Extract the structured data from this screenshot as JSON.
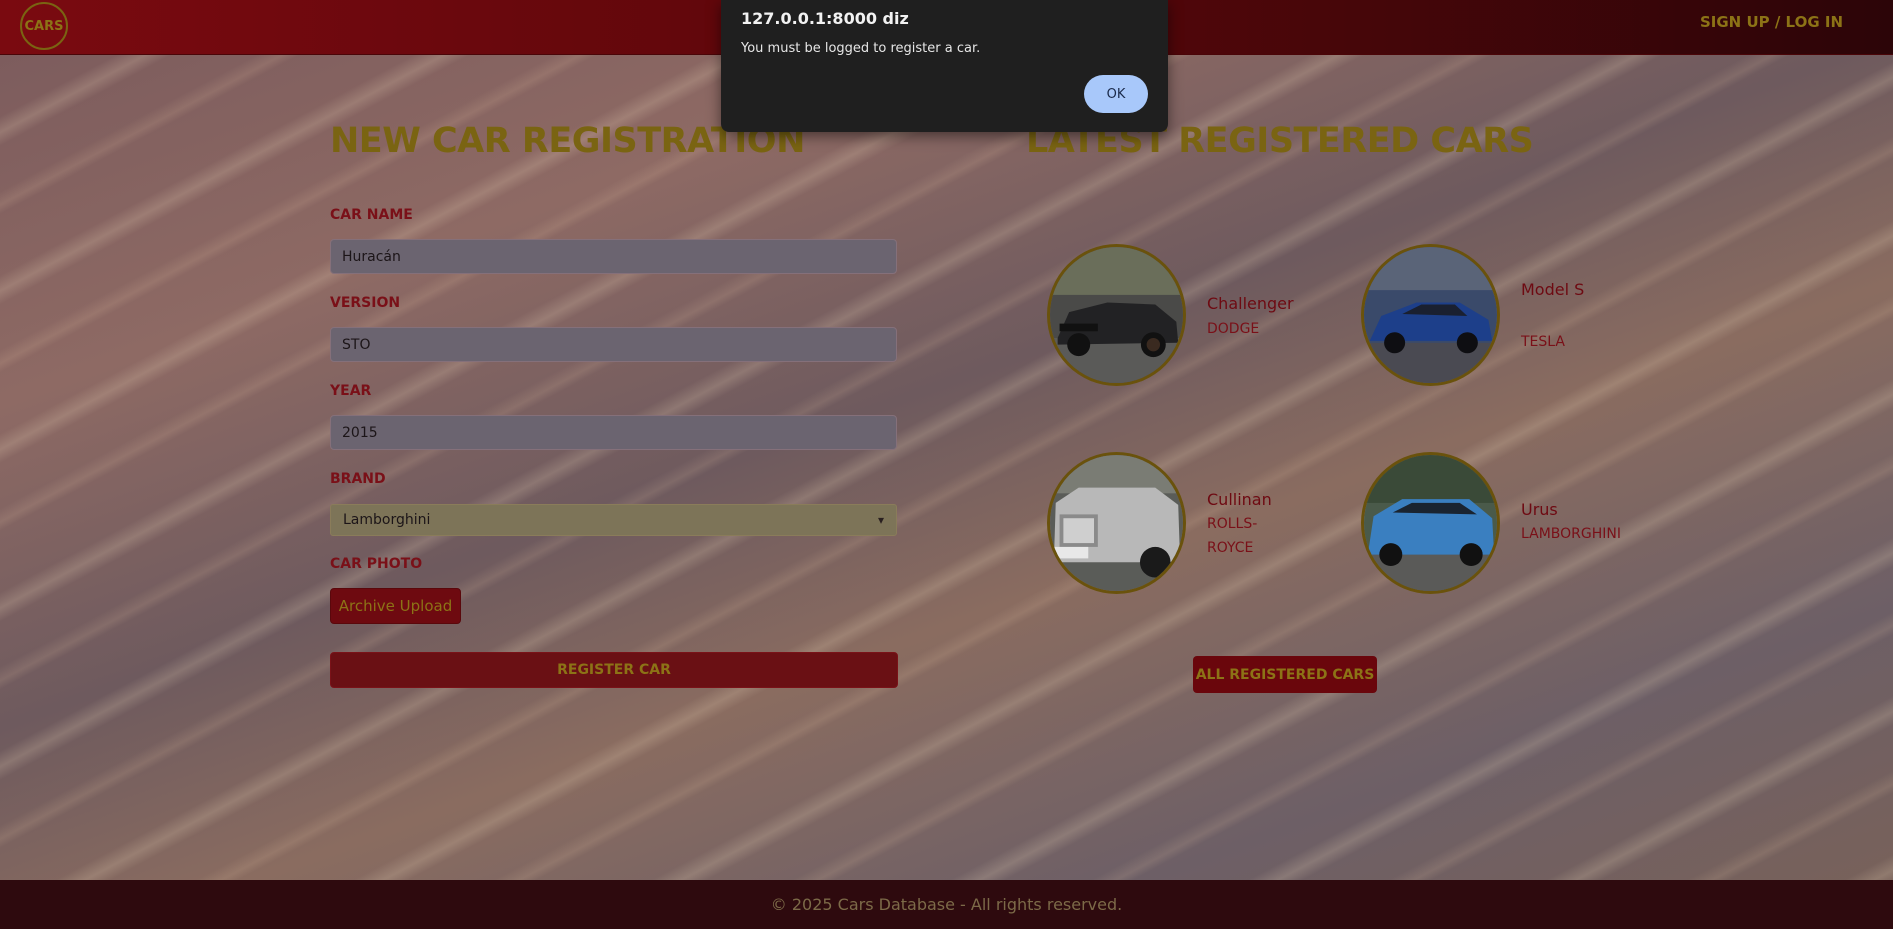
{
  "header": {
    "logo_text": "CARS",
    "login_link": "SIGN UP / LOG IN"
  },
  "form": {
    "title": "NEW CAR REGISTRATION",
    "car_name_label": "CAR NAME",
    "car_name_value": "Huracán",
    "version_label": "VERSION",
    "version_value": "STO",
    "year_label": "YEAR",
    "year_value": "2015",
    "brand_label": "BRAND",
    "brand_value": "Lamborghini",
    "photo_label": "CAR PHOTO",
    "upload_button": "Archive Upload",
    "submit_button": "REGISTER CAR"
  },
  "latest": {
    "title": "LATEST REGISTERED CARS",
    "cars": [
      {
        "name": "Challenger",
        "brand": "DODGE",
        "color": "#2a2a2c"
      },
      {
        "name": "Model S",
        "brand": "TESLA",
        "color": "#1d3f8a"
      },
      {
        "name": "Cullinan",
        "brand": "ROLLS-ROYCE",
        "color": "#c8c8c8"
      },
      {
        "name": "Urus",
        "brand": "LAMBORGHINI",
        "color": "#3a7fc0"
      }
    ],
    "all_button": "ALL REGISTERED CARS"
  },
  "footer": {
    "text": "© 2025 Cars Database - All rights reserved."
  },
  "alert": {
    "title": "127.0.0.1:8000 diz",
    "message": "You must be logged to register a car.",
    "ok_button": "OK"
  }
}
